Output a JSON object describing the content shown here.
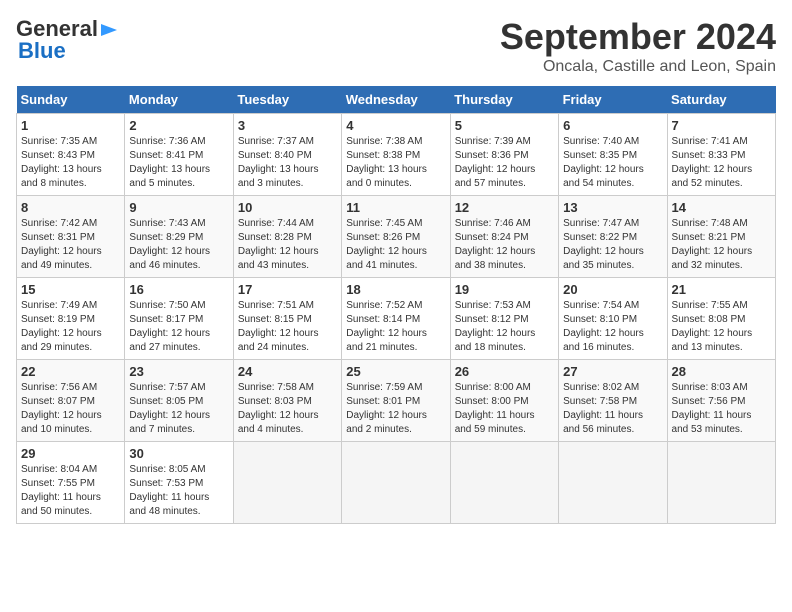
{
  "header": {
    "logo_general": "General",
    "logo_blue": "Blue",
    "month_title": "September 2024",
    "location": "Oncala, Castille and Leon, Spain"
  },
  "days_of_week": [
    "Sunday",
    "Monday",
    "Tuesday",
    "Wednesday",
    "Thursday",
    "Friday",
    "Saturday"
  ],
  "weeks": [
    [
      {
        "day": "1",
        "info": "Sunrise: 7:35 AM\nSunset: 8:43 PM\nDaylight: 13 hours\nand 8 minutes."
      },
      {
        "day": "2",
        "info": "Sunrise: 7:36 AM\nSunset: 8:41 PM\nDaylight: 13 hours\nand 5 minutes."
      },
      {
        "day": "3",
        "info": "Sunrise: 7:37 AM\nSunset: 8:40 PM\nDaylight: 13 hours\nand 3 minutes."
      },
      {
        "day": "4",
        "info": "Sunrise: 7:38 AM\nSunset: 8:38 PM\nDaylight: 13 hours\nand 0 minutes."
      },
      {
        "day": "5",
        "info": "Sunrise: 7:39 AM\nSunset: 8:36 PM\nDaylight: 12 hours\nand 57 minutes."
      },
      {
        "day": "6",
        "info": "Sunrise: 7:40 AM\nSunset: 8:35 PM\nDaylight: 12 hours\nand 54 minutes."
      },
      {
        "day": "7",
        "info": "Sunrise: 7:41 AM\nSunset: 8:33 PM\nDaylight: 12 hours\nand 52 minutes."
      }
    ],
    [
      {
        "day": "8",
        "info": "Sunrise: 7:42 AM\nSunset: 8:31 PM\nDaylight: 12 hours\nand 49 minutes."
      },
      {
        "day": "9",
        "info": "Sunrise: 7:43 AM\nSunset: 8:29 PM\nDaylight: 12 hours\nand 46 minutes."
      },
      {
        "day": "10",
        "info": "Sunrise: 7:44 AM\nSunset: 8:28 PM\nDaylight: 12 hours\nand 43 minutes."
      },
      {
        "day": "11",
        "info": "Sunrise: 7:45 AM\nSunset: 8:26 PM\nDaylight: 12 hours\nand 41 minutes."
      },
      {
        "day": "12",
        "info": "Sunrise: 7:46 AM\nSunset: 8:24 PM\nDaylight: 12 hours\nand 38 minutes."
      },
      {
        "day": "13",
        "info": "Sunrise: 7:47 AM\nSunset: 8:22 PM\nDaylight: 12 hours\nand 35 minutes."
      },
      {
        "day": "14",
        "info": "Sunrise: 7:48 AM\nSunset: 8:21 PM\nDaylight: 12 hours\nand 32 minutes."
      }
    ],
    [
      {
        "day": "15",
        "info": "Sunrise: 7:49 AM\nSunset: 8:19 PM\nDaylight: 12 hours\nand 29 minutes."
      },
      {
        "day": "16",
        "info": "Sunrise: 7:50 AM\nSunset: 8:17 PM\nDaylight: 12 hours\nand 27 minutes."
      },
      {
        "day": "17",
        "info": "Sunrise: 7:51 AM\nSunset: 8:15 PM\nDaylight: 12 hours\nand 24 minutes."
      },
      {
        "day": "18",
        "info": "Sunrise: 7:52 AM\nSunset: 8:14 PM\nDaylight: 12 hours\nand 21 minutes."
      },
      {
        "day": "19",
        "info": "Sunrise: 7:53 AM\nSunset: 8:12 PM\nDaylight: 12 hours\nand 18 minutes."
      },
      {
        "day": "20",
        "info": "Sunrise: 7:54 AM\nSunset: 8:10 PM\nDaylight: 12 hours\nand 16 minutes."
      },
      {
        "day": "21",
        "info": "Sunrise: 7:55 AM\nSunset: 8:08 PM\nDaylight: 12 hours\nand 13 minutes."
      }
    ],
    [
      {
        "day": "22",
        "info": "Sunrise: 7:56 AM\nSunset: 8:07 PM\nDaylight: 12 hours\nand 10 minutes."
      },
      {
        "day": "23",
        "info": "Sunrise: 7:57 AM\nSunset: 8:05 PM\nDaylight: 12 hours\nand 7 minutes."
      },
      {
        "day": "24",
        "info": "Sunrise: 7:58 AM\nSunset: 8:03 PM\nDaylight: 12 hours\nand 4 minutes."
      },
      {
        "day": "25",
        "info": "Sunrise: 7:59 AM\nSunset: 8:01 PM\nDaylight: 12 hours\nand 2 minutes."
      },
      {
        "day": "26",
        "info": "Sunrise: 8:00 AM\nSunset: 8:00 PM\nDaylight: 11 hours\nand 59 minutes."
      },
      {
        "day": "27",
        "info": "Sunrise: 8:02 AM\nSunset: 7:58 PM\nDaylight: 11 hours\nand 56 minutes."
      },
      {
        "day": "28",
        "info": "Sunrise: 8:03 AM\nSunset: 7:56 PM\nDaylight: 11 hours\nand 53 minutes."
      }
    ],
    [
      {
        "day": "29",
        "info": "Sunrise: 8:04 AM\nSunset: 7:55 PM\nDaylight: 11 hours\nand 50 minutes."
      },
      {
        "day": "30",
        "info": "Sunrise: 8:05 AM\nSunset: 7:53 PM\nDaylight: 11 hours\nand 48 minutes."
      },
      {
        "day": "",
        "info": ""
      },
      {
        "day": "",
        "info": ""
      },
      {
        "day": "",
        "info": ""
      },
      {
        "day": "",
        "info": ""
      },
      {
        "day": "",
        "info": ""
      }
    ]
  ]
}
